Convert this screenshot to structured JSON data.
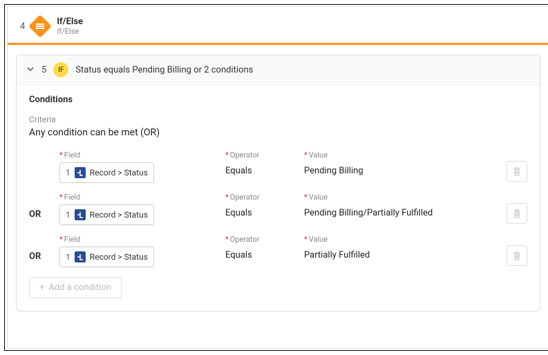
{
  "step": {
    "number": "4",
    "title": "If/Else",
    "subtitle": "If/Else"
  },
  "panel": {
    "number": "5",
    "badge": "IF",
    "summary": "Status equals Pending Billing or 2 conditions"
  },
  "conditions": {
    "heading": "Conditions",
    "criteria_label": "Criteria",
    "criteria_value": "Any condition can be met (OR)"
  },
  "labels": {
    "field": "Field",
    "operator": "Operator",
    "value": "Value",
    "or": "OR"
  },
  "rows": [
    {
      "prefix": "",
      "num": "1",
      "field": "Record > Status",
      "operator": "Equals",
      "value": "Pending Billing"
    },
    {
      "prefix": "OR",
      "num": "1",
      "field": "Record > Status",
      "operator": "Equals",
      "value": "Pending Billing/Partially Fulfilled"
    },
    {
      "prefix": "OR",
      "num": "1",
      "field": "Record > Status",
      "operator": "Equals",
      "value": "Partially Fulfilled"
    }
  ],
  "add_label": "Add a condition"
}
